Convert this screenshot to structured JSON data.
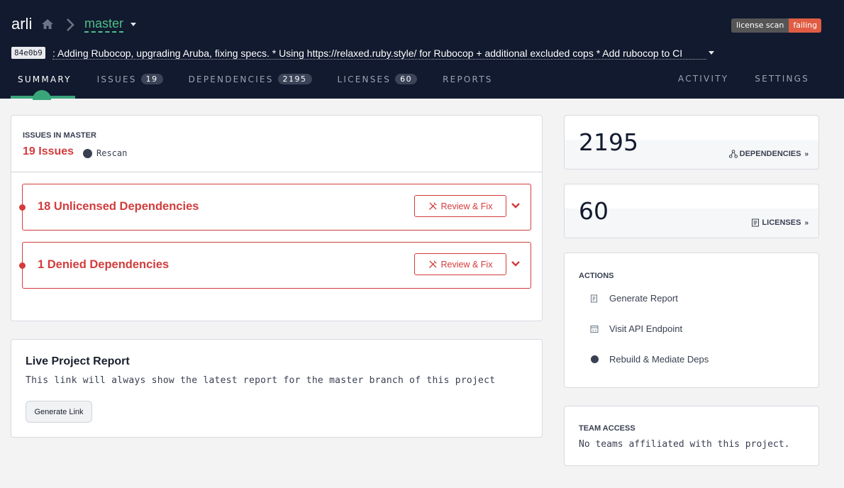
{
  "project": {
    "name": "arli",
    "branch": "master"
  },
  "icons": {
    "home": "home-icon",
    "separator": "chevron-right-icon",
    "branch_caret": "caret-down-icon"
  },
  "badge": {
    "left": "license scan",
    "right": "failing",
    "right_color": "#e05d44"
  },
  "commit": {
    "hash": "84e0b9",
    "message": ": Adding Rubocop, upgrading Aruba, fixing specs. * Using https://relaxed.ruby.style/ for Rubocop + additional excluded cops * Add rubocop to CI"
  },
  "tabs": {
    "summary": "SUMMARY",
    "issues": {
      "label": "ISSUES",
      "count": "19"
    },
    "dependencies": {
      "label": "DEPENDENCIES",
      "count": "2195"
    },
    "licenses": {
      "label": "LICENSES",
      "count": "60"
    },
    "reports": "REPORTS",
    "activity": "ACTIVITY",
    "settings": "SETTINGS"
  },
  "issues": {
    "label": "ISSUES IN MASTER",
    "count": "19 Issues",
    "rescan": "Rescan",
    "rows": [
      {
        "title": "18 Unlicensed Dependencies",
        "button": "Review & Fix"
      },
      {
        "title": "1 Denied Dependencies",
        "button": "Review & Fix"
      }
    ]
  },
  "report": {
    "title": "Live Project Report",
    "description": "This link will always show the latest report for the master branch of this project",
    "button": "Generate Link"
  },
  "stats": {
    "dependencies": {
      "value": "2195",
      "link": "DEPENDENCIES"
    },
    "licenses": {
      "value": "60",
      "link": "LICENSES"
    }
  },
  "actions": {
    "label": "ACTIONS",
    "items": [
      "Generate Report",
      "Visit API Endpoint",
      "Rebuild & Mediate Deps"
    ]
  },
  "team": {
    "label": "TEAM ACCESS",
    "description": "No teams affiliated with this project."
  },
  "colors": {
    "header_bg": "#111a2e",
    "accent_green": "#3aa57b",
    "danger_red": "#d23c3c"
  }
}
